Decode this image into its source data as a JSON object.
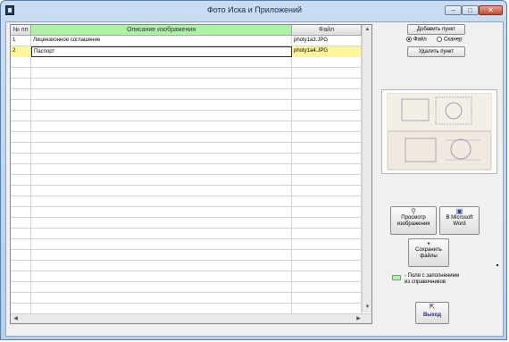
{
  "window": {
    "title": "Фото Иска и Приложений",
    "controls": {
      "minimize": "–",
      "maximize": "□",
      "close": "✕"
    }
  },
  "table": {
    "columns": {
      "num": "№ пп",
      "description": "Описание изображения",
      "file": "Файл"
    },
    "rows": [
      {
        "num": "1",
        "description": "Лицензионное соглашение",
        "file": "photy1a3.JPG"
      },
      {
        "num": "2",
        "description": "Паспорт",
        "file": "photy1a4.JPG"
      }
    ]
  },
  "buttons": {
    "add": "Добавить пункт",
    "delete": "Удалить пункт",
    "view_line1": "Просмотр",
    "view_line2": "изображения",
    "word_line1": "В Microsoft",
    "word_line2": "Word",
    "save_line1": "Сохранить",
    "save_line2": "файлы",
    "exit": "Выход"
  },
  "source": {
    "file_label": "Файл",
    "scanner_label": "Сканер",
    "selected": "file"
  },
  "legend": {
    "text_line1": "- Поля с заполнением",
    "text_line2": "из справочников"
  },
  "colors": {
    "header_green": "#aef2a6",
    "selected_row": "#fff79a",
    "exit_text": "#1a2a8c"
  }
}
